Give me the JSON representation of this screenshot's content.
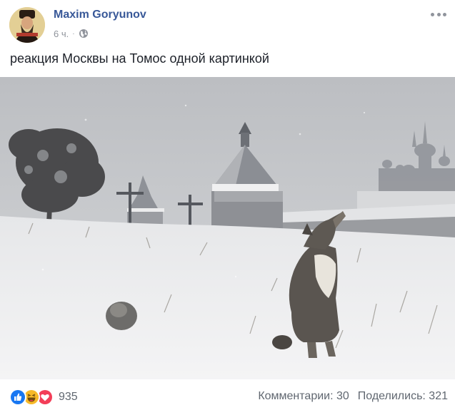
{
  "post": {
    "author": "Maxim Goryunov",
    "time": "6 ч.",
    "separator": "·",
    "privacy_icon": "globe-icon",
    "more_icon": "more-options-icon",
    "text": "реакция Москвы на Томос одной картинкой"
  },
  "reactions": {
    "icons": [
      "like-icon",
      "haha-icon",
      "love-icon"
    ],
    "count": "935"
  },
  "stats": {
    "comments": "Комментарии: 30",
    "shares": "Поделились: 321"
  },
  "colors": {
    "author_link": "#385898",
    "like": "#1877f2",
    "haha": "#f7b928",
    "love": "#f33e58",
    "secondary_text": "#606770"
  }
}
